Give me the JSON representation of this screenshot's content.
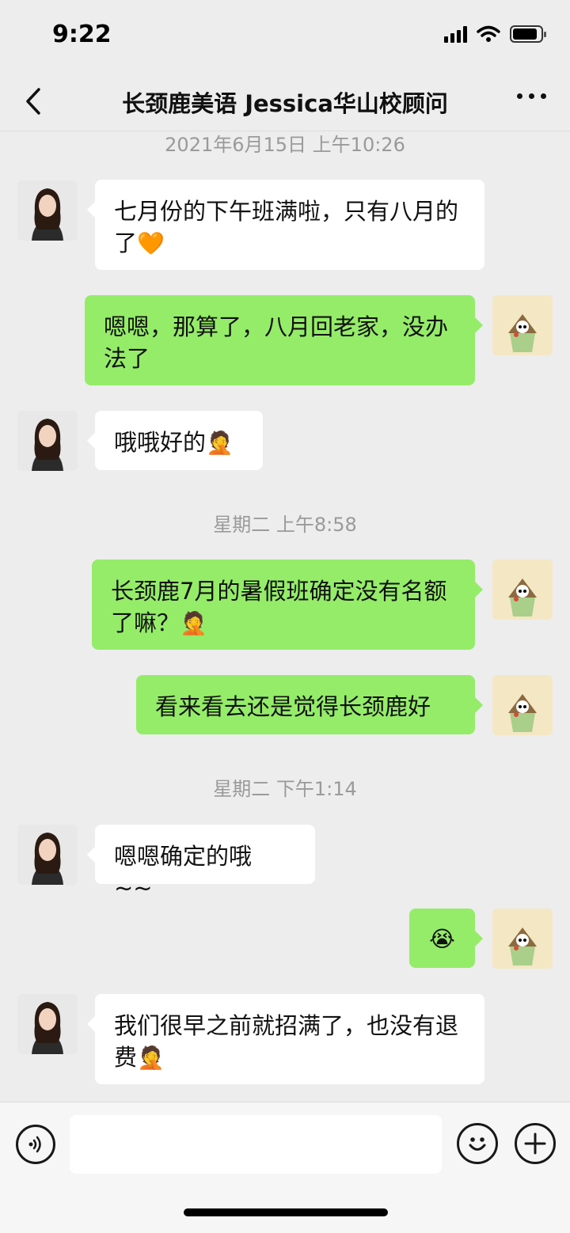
{
  "status_bar": {
    "time": "9:22"
  },
  "nav": {
    "title": "长颈鹿美语 Jessica华山校顾问"
  },
  "timestamps": [
    "2021年6月15日 上午10:26",
    "星期二 上午8:58",
    "星期二 下午1:14"
  ],
  "messages": [
    {
      "side": "left",
      "text": "七月份的下午班满啦，只有八月的了",
      "emoji": "🧡"
    },
    {
      "side": "right",
      "text": "嗯嗯，那算了，八月回老家，没办法了",
      "emoji": ""
    },
    {
      "side": "left",
      "text": "哦哦好的",
      "emoji": "🤦"
    },
    {
      "side": "right",
      "text": "长颈鹿7月的暑假班确定没有名额了嘛？",
      "emoji": "🤦"
    },
    {
      "side": "right",
      "text": "看来看去还是觉得长颈鹿好",
      "emoji": ""
    },
    {
      "side": "left",
      "text": "嗯嗯确定的哦 ~~",
      "emoji": ""
    },
    {
      "side": "right",
      "text": "",
      "emoji": "😭"
    },
    {
      "side": "left",
      "text": "我们很早之前就招满了，也没有退费",
      "emoji": "🤦"
    }
  ],
  "colors": {
    "background": "#ededed",
    "bubble_self": "#95ec69",
    "bubble_other": "#ffffff"
  },
  "icons": {
    "back": "chevron-left-icon",
    "more": "more-dots-icon",
    "voice": "voice-icon",
    "emoji": "emoji-face-icon",
    "plus": "plus-icon"
  }
}
